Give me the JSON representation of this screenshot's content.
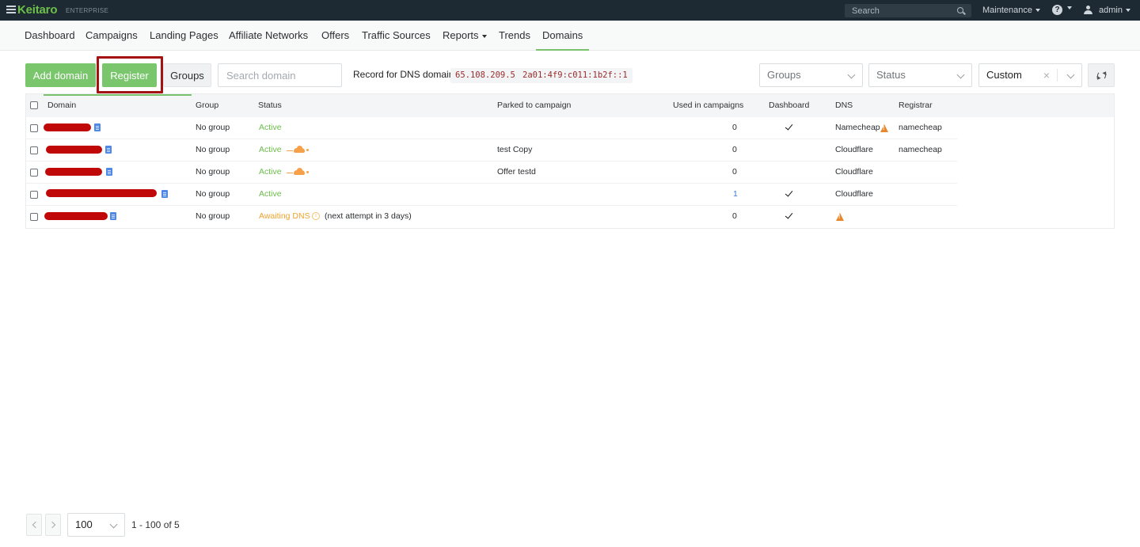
{
  "topbar": {
    "logo": "Keitaro",
    "edition": "ENTERPRISE",
    "search_placeholder": "Search",
    "maintenance": "Maintenance",
    "help": "?",
    "user": "admin"
  },
  "nav": [
    {
      "label": "Dashboard"
    },
    {
      "label": "Campaigns"
    },
    {
      "label": "Landing Pages"
    },
    {
      "label": "Affiliate Networks"
    },
    {
      "label": "Offers"
    },
    {
      "label": "Traffic Sources"
    },
    {
      "label": "Reports"
    },
    {
      "label": "Trends"
    },
    {
      "label": "Domains",
      "active": true
    }
  ],
  "toolbar": {
    "add_domain": "Add domain",
    "register": "Register",
    "groups_button": "Groups",
    "search_placeholder": "Search domain",
    "dns_label": "Record for DNS domain:",
    "dns_ipv4": "65.108.209.5",
    "dns_ipv6": "2a01:4f9:c011:1b2f::1",
    "groups_select": "Groups",
    "status_select": "Status",
    "period_select": "Custom",
    "clear": "×"
  },
  "table": {
    "headers": {
      "domain": "Domain",
      "group": "Group",
      "status": "Status",
      "parked": "Parked to campaign",
      "used": "Used in campaigns",
      "dashboard": "Dashboard",
      "dns": "DNS",
      "registrar": "Registrar"
    },
    "rows": [
      {
        "group": "No group",
        "status": "Active",
        "parked": "",
        "used": "0",
        "dns": "Namecheap",
        "registrar": "namecheap"
      },
      {
        "group": "No group",
        "status": "Active",
        "parked": "test Copy",
        "used": "0",
        "dns": "Cloudflare",
        "registrar": "namecheap"
      },
      {
        "group": "No group",
        "status": "Active",
        "parked": "Offer testd",
        "used": "0",
        "dns": "Cloudflare",
        "registrar": ""
      },
      {
        "group": "No group",
        "status": "Active",
        "parked": "",
        "used": "1",
        "dns": "Cloudflare",
        "registrar": ""
      },
      {
        "group": "No group",
        "status": "Awaiting DNS",
        "status_note": "(next attempt in 3 days)",
        "parked": "",
        "used": "0",
        "dns": "",
        "registrar": ""
      }
    ]
  },
  "pagination": {
    "per_page": "100",
    "info": "1 - 100 of 5"
  },
  "colors": {
    "accent_green": "#7ac66d",
    "highlight_red": "#a41313",
    "topbar": "#1e2a33"
  }
}
